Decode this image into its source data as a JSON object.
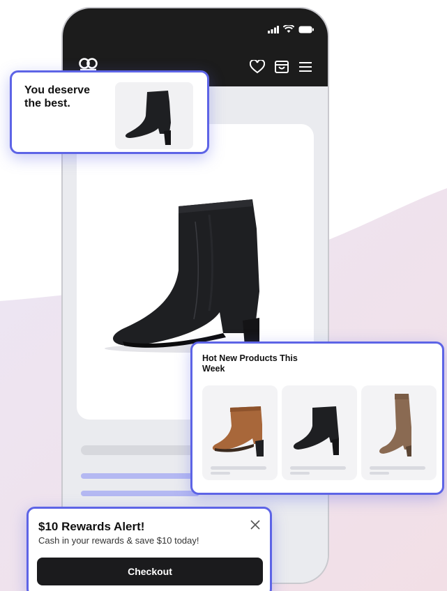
{
  "app": {
    "brand_icon": "logo-icon",
    "nav_icons": [
      "heart-icon",
      "cart-icon",
      "menu-icon"
    ],
    "status_icons": [
      "signal-icon",
      "wifi-icon",
      "battery-icon"
    ]
  },
  "promo_popup": {
    "title": "You deserve the best."
  },
  "hot_products": {
    "title": "Hot New Products This Week",
    "items": [
      "brown-ankle-boot",
      "black-ankle-boot",
      "tan-knee-boot"
    ]
  },
  "rewards_alert": {
    "title": "$10 Rewards Alert!",
    "subtitle": "Cash in your rewards & save $10 today!",
    "button_label": "Checkout"
  },
  "colors": {
    "accent": "#5d64e6",
    "dark": "#1b1b1d",
    "skeleton": "#d9dae0",
    "skeleton_accent": "#b4b8f2"
  }
}
